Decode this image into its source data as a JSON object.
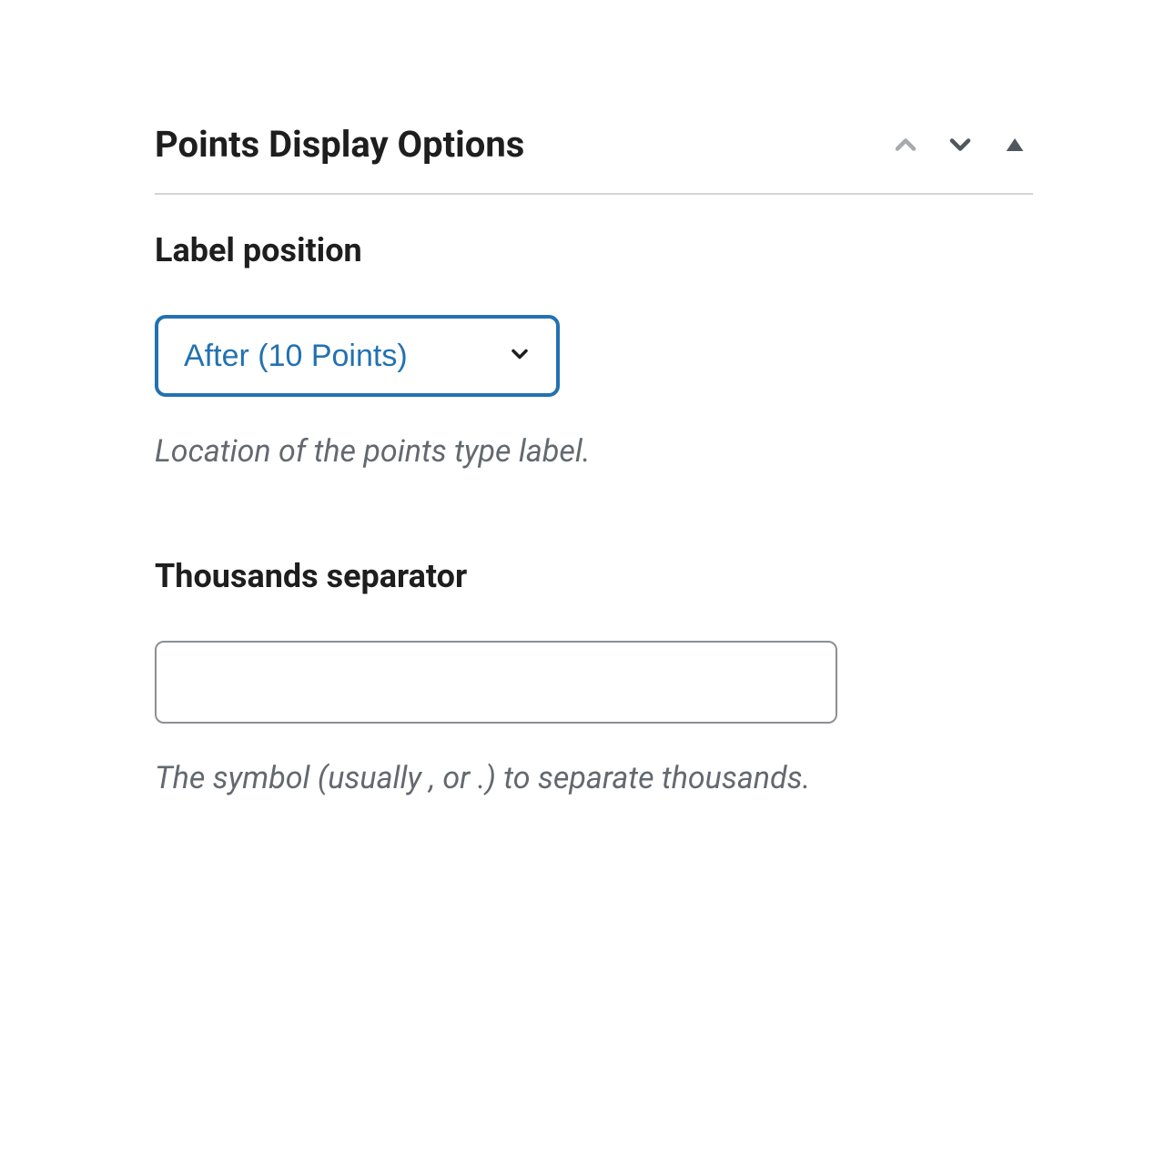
{
  "panel": {
    "title": "Points Display Options"
  },
  "fields": {
    "labelPosition": {
      "label": "Label position",
      "selected": "After (10 Points)",
      "description": "Location of the points type label."
    },
    "thousandsSeparator": {
      "label": "Thousands separator",
      "value": "",
      "description": "The symbol (usually , or .) to separate thousands."
    }
  },
  "colors": {
    "accent": "#2271b1",
    "text": "#1e1e1e",
    "muted": "#646970",
    "border": "#8c8f94",
    "divider": "#d4d4d4",
    "chevronLight": "#a7aaad",
    "chevronDark": "#50575e"
  }
}
